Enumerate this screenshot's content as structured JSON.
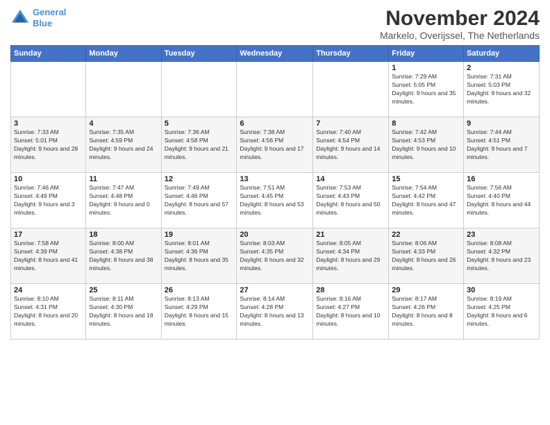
{
  "header": {
    "logo_line1": "General",
    "logo_line2": "Blue",
    "title": "November 2024",
    "subtitle": "Markelo, Overijssel, The Netherlands"
  },
  "weekdays": [
    "Sunday",
    "Monday",
    "Tuesday",
    "Wednesday",
    "Thursday",
    "Friday",
    "Saturday"
  ],
  "weeks": [
    [
      {
        "day": "",
        "info": ""
      },
      {
        "day": "",
        "info": ""
      },
      {
        "day": "",
        "info": ""
      },
      {
        "day": "",
        "info": ""
      },
      {
        "day": "",
        "info": ""
      },
      {
        "day": "1",
        "info": "Sunrise: 7:29 AM\nSunset: 5:05 PM\nDaylight: 9 hours and 35 minutes."
      },
      {
        "day": "2",
        "info": "Sunrise: 7:31 AM\nSunset: 5:03 PM\nDaylight: 9 hours and 32 minutes."
      }
    ],
    [
      {
        "day": "3",
        "info": "Sunrise: 7:33 AM\nSunset: 5:01 PM\nDaylight: 9 hours and 28 minutes."
      },
      {
        "day": "4",
        "info": "Sunrise: 7:35 AM\nSunset: 4:59 PM\nDaylight: 9 hours and 24 minutes."
      },
      {
        "day": "5",
        "info": "Sunrise: 7:36 AM\nSunset: 4:58 PM\nDaylight: 9 hours and 21 minutes."
      },
      {
        "day": "6",
        "info": "Sunrise: 7:38 AM\nSunset: 4:56 PM\nDaylight: 9 hours and 17 minutes."
      },
      {
        "day": "7",
        "info": "Sunrise: 7:40 AM\nSunset: 4:54 PM\nDaylight: 9 hours and 14 minutes."
      },
      {
        "day": "8",
        "info": "Sunrise: 7:42 AM\nSunset: 4:53 PM\nDaylight: 9 hours and 10 minutes."
      },
      {
        "day": "9",
        "info": "Sunrise: 7:44 AM\nSunset: 4:51 PM\nDaylight: 9 hours and 7 minutes."
      }
    ],
    [
      {
        "day": "10",
        "info": "Sunrise: 7:46 AM\nSunset: 4:49 PM\nDaylight: 9 hours and 3 minutes."
      },
      {
        "day": "11",
        "info": "Sunrise: 7:47 AM\nSunset: 4:48 PM\nDaylight: 9 hours and 0 minutes."
      },
      {
        "day": "12",
        "info": "Sunrise: 7:49 AM\nSunset: 4:46 PM\nDaylight: 8 hours and 57 minutes."
      },
      {
        "day": "13",
        "info": "Sunrise: 7:51 AM\nSunset: 4:45 PM\nDaylight: 8 hours and 53 minutes."
      },
      {
        "day": "14",
        "info": "Sunrise: 7:53 AM\nSunset: 4:43 PM\nDaylight: 8 hours and 50 minutes."
      },
      {
        "day": "15",
        "info": "Sunrise: 7:54 AM\nSunset: 4:42 PM\nDaylight: 8 hours and 47 minutes."
      },
      {
        "day": "16",
        "info": "Sunrise: 7:56 AM\nSunset: 4:40 PM\nDaylight: 8 hours and 44 minutes."
      }
    ],
    [
      {
        "day": "17",
        "info": "Sunrise: 7:58 AM\nSunset: 4:39 PM\nDaylight: 8 hours and 41 minutes."
      },
      {
        "day": "18",
        "info": "Sunrise: 8:00 AM\nSunset: 4:38 PM\nDaylight: 8 hours and 38 minutes."
      },
      {
        "day": "19",
        "info": "Sunrise: 8:01 AM\nSunset: 4:36 PM\nDaylight: 8 hours and 35 minutes."
      },
      {
        "day": "20",
        "info": "Sunrise: 8:03 AM\nSunset: 4:35 PM\nDaylight: 8 hours and 32 minutes."
      },
      {
        "day": "21",
        "info": "Sunrise: 8:05 AM\nSunset: 4:34 PM\nDaylight: 8 hours and 29 minutes."
      },
      {
        "day": "22",
        "info": "Sunrise: 8:06 AM\nSunset: 4:33 PM\nDaylight: 8 hours and 26 minutes."
      },
      {
        "day": "23",
        "info": "Sunrise: 8:08 AM\nSunset: 4:32 PM\nDaylight: 8 hours and 23 minutes."
      }
    ],
    [
      {
        "day": "24",
        "info": "Sunrise: 8:10 AM\nSunset: 4:31 PM\nDaylight: 8 hours and 20 minutes."
      },
      {
        "day": "25",
        "info": "Sunrise: 8:11 AM\nSunset: 4:30 PM\nDaylight: 8 hours and 18 minutes."
      },
      {
        "day": "26",
        "info": "Sunrise: 8:13 AM\nSunset: 4:29 PM\nDaylight: 8 hours and 15 minutes."
      },
      {
        "day": "27",
        "info": "Sunrise: 8:14 AM\nSunset: 4:28 PM\nDaylight: 8 hours and 13 minutes."
      },
      {
        "day": "28",
        "info": "Sunrise: 8:16 AM\nSunset: 4:27 PM\nDaylight: 8 hours and 10 minutes."
      },
      {
        "day": "29",
        "info": "Sunrise: 8:17 AM\nSunset: 4:26 PM\nDaylight: 8 hours and 8 minutes."
      },
      {
        "day": "30",
        "info": "Sunrise: 8:19 AM\nSunset: 4:25 PM\nDaylight: 8 hours and 6 minutes."
      }
    ]
  ]
}
